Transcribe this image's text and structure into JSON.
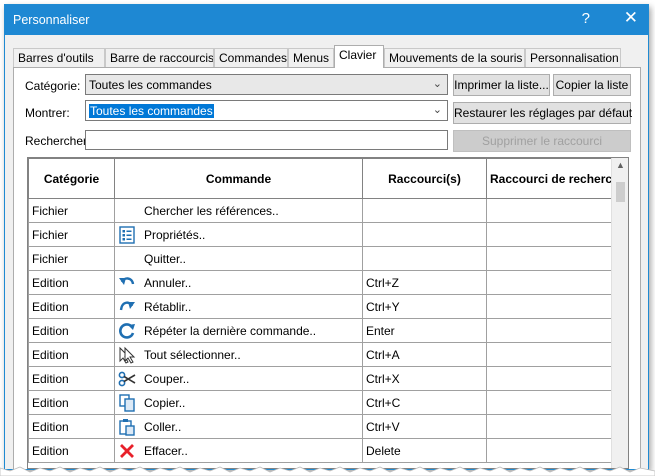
{
  "window": {
    "title": "Personnaliser",
    "help_glyph": "?",
    "close_glyph": "✕"
  },
  "tabs": [
    {
      "label": "Barres d'outils"
    },
    {
      "label": "Barre de raccourcis"
    },
    {
      "label": "Commandes"
    },
    {
      "label": "Menus"
    },
    {
      "label": "Clavier",
      "active": true
    },
    {
      "label": "Mouvements de la souris"
    },
    {
      "label": "Personnalisation"
    }
  ],
  "form": {
    "category_label": "Catégorie:",
    "category_value": "Toutes les commandes",
    "show_label": "Montrer:",
    "show_value": "Toutes les commandes",
    "search_label": "Rechercher:",
    "search_value": ""
  },
  "buttons": {
    "print_list": "Imprimer la liste...",
    "copy_list": "Copier la liste",
    "restore_defaults": "Restaurer les réglages par défaut",
    "remove_shortcut": "Supprimer le raccourci"
  },
  "table": {
    "headers": [
      "Catégorie",
      "Commande",
      "Raccourci(s)",
      "Raccourci de recherche"
    ],
    "rows": [
      {
        "category": "Fichier",
        "command": "Chercher les références..",
        "shortcut": "",
        "icon": "none"
      },
      {
        "category": "Fichier",
        "command": "Propriétés..",
        "shortcut": "",
        "icon": "properties-icon"
      },
      {
        "category": "Fichier",
        "command": "Quitter..",
        "shortcut": "",
        "icon": "none"
      },
      {
        "category": "Edition",
        "command": "Annuler..",
        "shortcut": "Ctrl+Z",
        "icon": "undo-icon"
      },
      {
        "category": "Edition",
        "command": "Rétablir..",
        "shortcut": "Ctrl+Y",
        "icon": "redo-icon"
      },
      {
        "category": "Edition",
        "command": "Répéter la dernière commande..",
        "shortcut": "Enter",
        "icon": "repeat-icon"
      },
      {
        "category": "Edition",
        "command": "Tout sélectionner..",
        "shortcut": "Ctrl+A",
        "icon": "select-all-icon"
      },
      {
        "category": "Edition",
        "command": "Couper..",
        "shortcut": "Ctrl+X",
        "icon": "scissors-icon"
      },
      {
        "category": "Edition",
        "command": "Copier..",
        "shortcut": "Ctrl+C",
        "icon": "copy-icon"
      },
      {
        "category": "Edition",
        "command": "Coller..",
        "shortcut": "Ctrl+V",
        "icon": "paste-icon"
      },
      {
        "category": "Edition",
        "command": "Effacer..",
        "shortcut": "Delete",
        "icon": "delete-icon"
      }
    ]
  },
  "colors": {
    "titlebar": "#1e88d3",
    "selection": "#0078d7",
    "icon_blue": "#1f6fb2",
    "delete_red": "#e8202a"
  }
}
